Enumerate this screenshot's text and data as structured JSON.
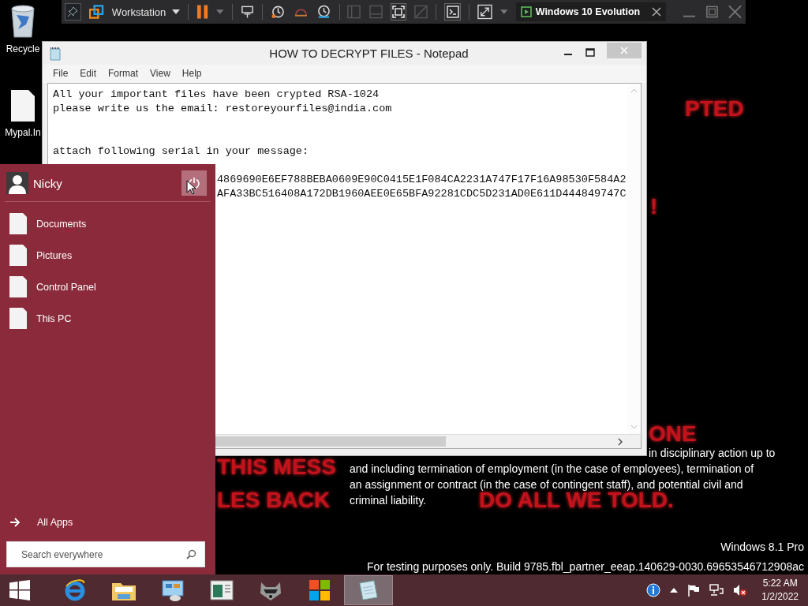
{
  "vm_toolbar": {
    "menu_label": "Workstation",
    "tab": {
      "title": "Windows 10 Evolution"
    }
  },
  "desktop_icons": [
    {
      "label": "Recycle",
      "kind": "recycle"
    },
    {
      "label": "Mypal.In",
      "kind": "file"
    }
  ],
  "background_text": {
    "red_fragments": [
      {
        "text": "PTED",
        "kind": "right"
      },
      {
        "text": "!",
        "kind": "right-low"
      },
      {
        "text": "ONE",
        "kind": "under-window"
      },
      {
        "text": "THIS MESS",
        "kind": "left-1"
      },
      {
        "text": "LES BACK",
        "kind": "left-2"
      },
      {
        "text": "DO ALL WE TOLD.",
        "kind": "mid-2"
      }
    ],
    "notice_lines": [
      {
        "text": "in disciplinary action up to",
        "kind": "tail"
      },
      {
        "text": "and including termination of employment (in the case of employees), termination of",
        "kind": "full"
      },
      {
        "text": "an assignment or contract (in the case of contingent staff), and potential civil and",
        "kind": "full"
      },
      {
        "text": "criminal liability.",
        "kind": "full"
      }
    ],
    "edition": "Windows 8.1 Pro",
    "build": "For testing purposes only. Build 9785.fbl_partner_eeap.140629-0030.69653546712908ac"
  },
  "notepad": {
    "title": "HOW TO DECRYPT FILES - Notepad",
    "menu": [
      "File",
      "Edit",
      "Format",
      "View",
      "Help"
    ],
    "lines": [
      {
        "kind": "line",
        "text": "All your important files have been crypted RSA-1024"
      },
      {
        "kind": "line",
        "text": "please write us the email: restoreyourfiles@india.com"
      },
      {
        "kind": "blank"
      },
      {
        "kind": "blank"
      },
      {
        "kind": "line",
        "text": "attach following serial in your message:"
      },
      {
        "kind": "blank"
      },
      {
        "kind": "serial",
        "text": "4869690E6EF788BEBA0609E90C0415E1F084CA2231A747F17F16A98530F584A2"
      },
      {
        "kind": "serial",
        "text": "AFA33BC516408A172DB1960AEE0E65BFA92281CDC5D231AD0E611D444849747C"
      }
    ]
  },
  "start_menu": {
    "user": "Nicky",
    "items": [
      "Documents",
      "Pictures",
      "Control Panel",
      "This PC"
    ],
    "all_apps": "All Apps",
    "search": {
      "placeholder": "Search everywhere"
    }
  },
  "taskbar": {
    "apps": [
      {
        "kind": "ie",
        "selected": false
      },
      {
        "kind": "folder",
        "selected": false
      },
      {
        "kind": "panel",
        "selected": false
      },
      {
        "kind": "window",
        "selected": false
      },
      {
        "kind": "raccoon",
        "selected": false
      },
      {
        "kind": "store",
        "selected": false
      },
      {
        "kind": "notepad",
        "selected": true
      }
    ],
    "clock": {
      "time": "5:22 AM",
      "date": "1/2/2022"
    }
  }
}
